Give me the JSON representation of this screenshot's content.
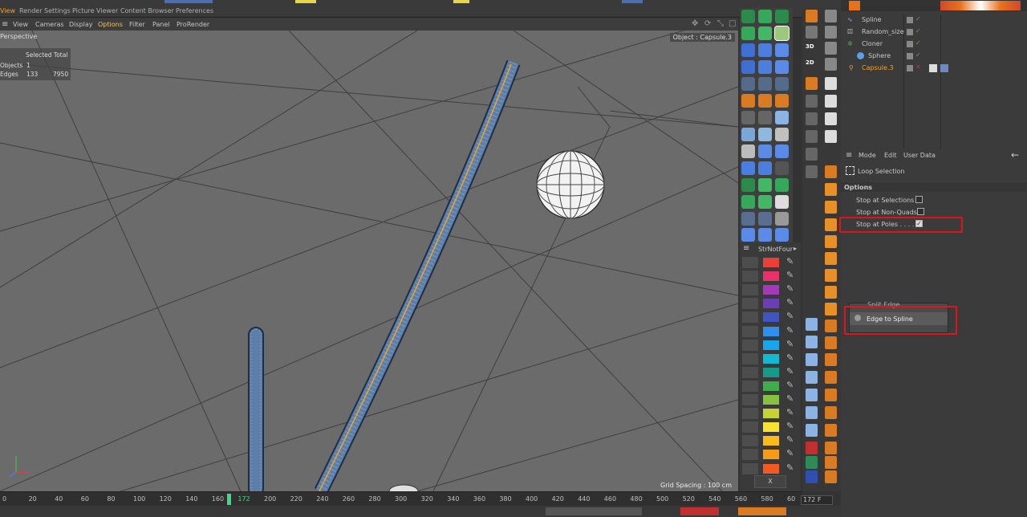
{
  "menubar": {
    "items": [
      "View",
      "Render Settings",
      "Picture Viewer",
      "Content Browser",
      "Preferences"
    ]
  },
  "viewport_menu": {
    "items": [
      "View",
      "Cameras",
      "Display",
      "Options",
      "Filter",
      "Panel",
      "ProRender"
    ],
    "active": "Options"
  },
  "viewport": {
    "label": "Perspective",
    "object_label": "Object : Capsule.3",
    "grid_spacing": "Grid Spacing : 100 cm",
    "hud": {
      "header": "Selected Total",
      "rows": [
        {
          "label": "Objects",
          "selected": "1",
          "total": ""
        },
        {
          "label": "Edges",
          "selected": "133",
          "total": "7950"
        }
      ]
    }
  },
  "color_panel": {
    "title": "StrNotFour",
    "close_label": "X",
    "swatches": [
      "#e8413a",
      "#e8316a",
      "#a33bb6",
      "#6a3fb6",
      "#3f56c0",
      "#2f8fea",
      "#17a6ec",
      "#13b9d0",
      "#149b8a",
      "#3fae4a",
      "#86c13f",
      "#c6d235",
      "#f7e233",
      "#f9bd1a",
      "#f79a16",
      "#f25a22"
    ]
  },
  "object_manager": {
    "objects": [
      {
        "name": "Spline",
        "icon": "spline-icon"
      },
      {
        "name": "Random_size",
        "icon": "random-effector-icon"
      },
      {
        "name": "Cloner",
        "icon": "cloner-icon"
      },
      {
        "name": "Sphere",
        "icon": "sphere-icon"
      },
      {
        "name": "Capsule.3",
        "icon": "capsule-icon",
        "selected": true
      }
    ]
  },
  "attributes": {
    "tabs": [
      "Mode",
      "Edit",
      "User Data"
    ],
    "tool_name": "Loop Selection",
    "section": "Options",
    "options": [
      {
        "label": "Stop at Selections",
        "checked": false
      },
      {
        "label": "Stop at Non-Quads",
        "checked": false
      },
      {
        "label": "Stop at Poles . . . . .",
        "checked": true
      }
    ]
  },
  "context_menu": {
    "partial_item": "Split Edge",
    "item": "Edge to Spline"
  },
  "timeline": {
    "ticks": [
      "0",
      "20",
      "40",
      "60",
      "80",
      "100",
      "120",
      "140",
      "160",
      "172",
      "200",
      "220",
      "240",
      "260",
      "280",
      "300",
      "320",
      "340",
      "360",
      "380",
      "400",
      "420",
      "440",
      "460",
      "480",
      "500",
      "520",
      "540",
      "560",
      "580",
      "60"
    ],
    "current_frame": "172",
    "frame_field": "172 F"
  },
  "colors": {
    "accent": "#f7a21b",
    "highlight_red": "#e0151b",
    "viewport_bg": "#6b6b6b",
    "timeline_marker": "#3ddc84"
  }
}
